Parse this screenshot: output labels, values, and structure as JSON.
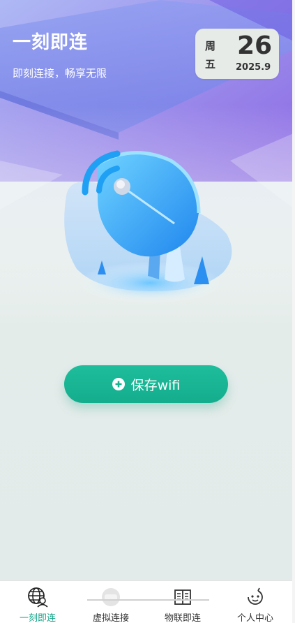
{
  "header": {
    "title": "一刻即连",
    "subtitle": "即刻连接，畅享无限"
  },
  "date_card": {
    "weekday_line1": "周",
    "weekday_line2": "五",
    "day": "26",
    "year_month": "2025.9"
  },
  "main": {
    "save_button_label": "保存wifi",
    "save_button_icon": "plus-circle-icon"
  },
  "tabbar": {
    "items": [
      {
        "label": "一刻即连",
        "icon": "globe-user-icon",
        "active": true
      },
      {
        "label": "虚拟连接",
        "icon": "vr-headset-icon",
        "active": false
      },
      {
        "label": "物联即连",
        "icon": "book-icon",
        "active": false
      },
      {
        "label": "个人中心",
        "icon": "smiley-face-icon",
        "active": false
      }
    ]
  },
  "colors": {
    "accent": "#1aa58a",
    "button": "#16b290",
    "hero_purple": "#7b4fe0",
    "dish_blue": "#2aa6f5"
  }
}
